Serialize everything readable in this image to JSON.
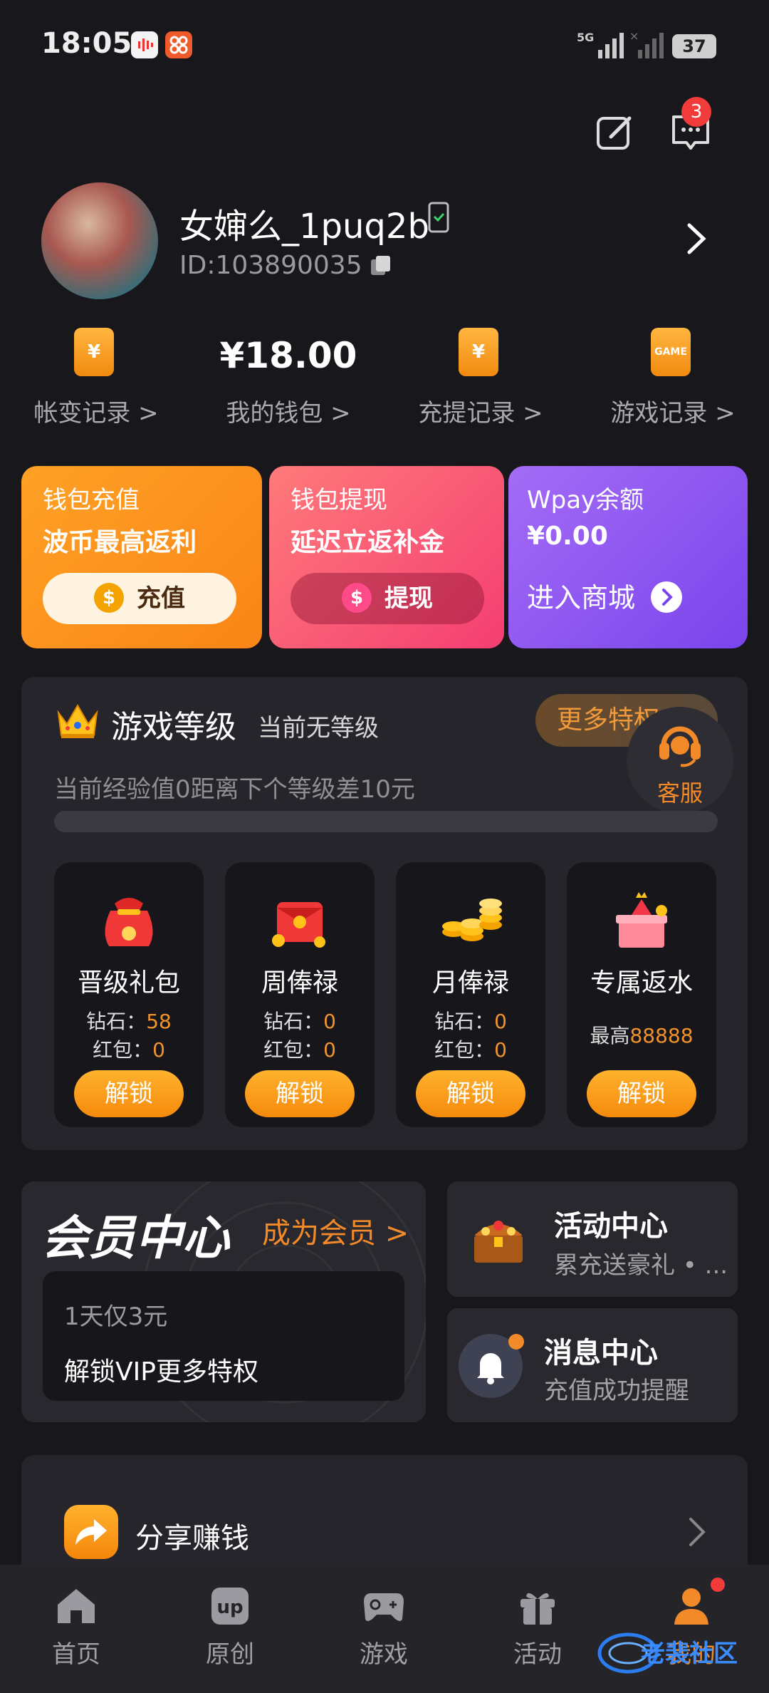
{
  "status_bar": {
    "time": "18:05",
    "network": "5G",
    "battery": "37"
  },
  "header": {
    "message_badge": "3"
  },
  "profile": {
    "username": "女婶么_1puq2b",
    "user_id": "ID:103890035"
  },
  "records": [
    {
      "label": "帐变记录 >",
      "icon": "yen-wallet-icon"
    },
    {
      "label": "我的钱包 >",
      "amount": "¥18.00"
    },
    {
      "label": "充提记录 >",
      "icon": "yen-wallet-icon"
    },
    {
      "label": "游戏记录 >",
      "icon": "game-phone-icon"
    }
  ],
  "cards": {
    "recharge": {
      "title": "钱包充值",
      "subtitle": "波币最高返利",
      "button": "充值",
      "coin": "$"
    },
    "withdraw": {
      "title": "钱包提现",
      "subtitle": "延迟立返补金",
      "button": "提现",
      "coin": "$"
    },
    "wpay": {
      "title": "Wpay余额",
      "amount": "¥0.00",
      "link": "进入商城"
    }
  },
  "level": {
    "title": "游戏等级",
    "status": "当前无等级",
    "more_button": "更多特权",
    "exp_text": "当前经验值0距离下个等级差10元",
    "progress": 0,
    "customer_service": "客服",
    "diamond_label": "钻石：",
    "redpacket_label": "红包：",
    "rewards": [
      {
        "name": "晋级礼包",
        "diamond": "58",
        "redpacket": "0",
        "button": "解锁"
      },
      {
        "name": "周俸禄",
        "diamond": "0",
        "redpacket": "0",
        "button": "解锁"
      },
      {
        "name": "月俸禄",
        "diamond": "0",
        "redpacket": "0",
        "button": "解锁"
      },
      {
        "name": "专属返水",
        "max_label": "最高",
        "max_value": "88888",
        "button": "解锁"
      }
    ]
  },
  "member": {
    "title": "会员中心",
    "link": "成为会员 >",
    "price": "1天仅3元",
    "vip_text": "解锁VIP更多特权"
  },
  "activity": {
    "title": "活动中心",
    "subtitle": "累充送豪礼 • ..."
  },
  "messages": {
    "title": "消息中心",
    "subtitle": "充值成功提醒"
  },
  "share": {
    "label": "分享赚钱"
  },
  "nav": [
    {
      "label": "首页",
      "icon": "home-icon"
    },
    {
      "label": "原创",
      "icon": "up-icon"
    },
    {
      "label": "游戏",
      "icon": "gamepad-icon"
    },
    {
      "label": "活动",
      "icon": "gift-icon"
    },
    {
      "label": "我的",
      "icon": "person-icon"
    }
  ],
  "watermark": "老裴社区",
  "colors": {
    "accent": "#f28a2a",
    "background": "#17171c",
    "card": "#25252b"
  }
}
